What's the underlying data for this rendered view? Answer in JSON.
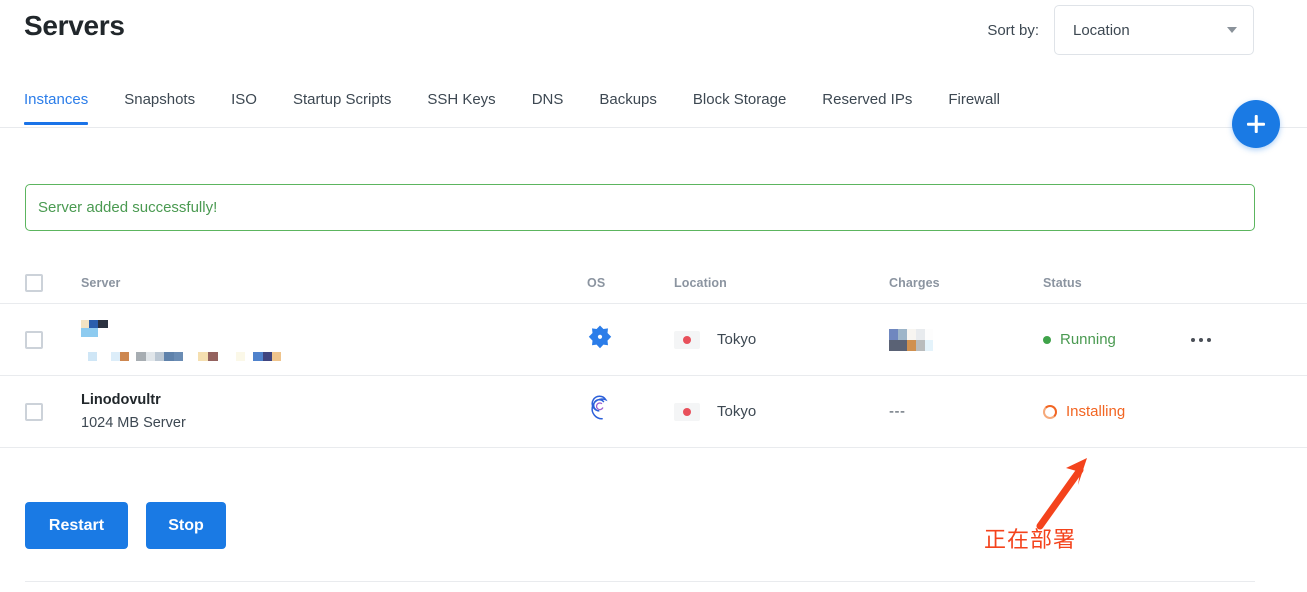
{
  "header": {
    "title": "Servers",
    "sort_label": "Sort by:",
    "sort_value": "Location",
    "sort_options": [
      "Location"
    ],
    "caret_icon": "chevron-down-icon"
  },
  "fab": {
    "icon": "plus-icon",
    "label": "+"
  },
  "tabs": [
    {
      "label": "Instances",
      "active": true
    },
    {
      "label": "Snapshots",
      "active": false
    },
    {
      "label": "ISO",
      "active": false
    },
    {
      "label": "Startup Scripts",
      "active": false
    },
    {
      "label": "SSH Keys",
      "active": false
    },
    {
      "label": "DNS",
      "active": false
    },
    {
      "label": "Backups",
      "active": false
    },
    {
      "label": "Block Storage",
      "active": false
    },
    {
      "label": "Reserved IPs",
      "active": false
    },
    {
      "label": "Firewall",
      "active": false
    }
  ],
  "alert": {
    "message": "Server added successfully!",
    "border_color": "#5cb55f",
    "text_color": "#4a9a51"
  },
  "table": {
    "columns": [
      "Server",
      "OS",
      "Location",
      "Charges",
      "Status"
    ],
    "rows": [
      {
        "server_name": "",
        "server_sub": "",
        "redacted": true,
        "os_icon": "vultr-starburst-icon",
        "location": "Tokyo",
        "flag_icon": "japan-flag-icon",
        "charges": "",
        "charges_redacted": true,
        "status": "Running",
        "status_icon": "green-dot-icon",
        "status_color": "#4a9a51",
        "menu_icon": "kebab-menu-icon"
      },
      {
        "server_name": "Linodovultr",
        "server_sub": "1024 MB Server",
        "redacted": false,
        "os_icon": "debian-swirl-icon",
        "location": "Tokyo",
        "flag_icon": "japan-flag-icon",
        "charges": "---",
        "charges_redacted": false,
        "status": "Installing",
        "status_icon": "spinner-icon",
        "status_color": "#f26522",
        "menu_icon": ""
      }
    ]
  },
  "actions": [
    {
      "label": "Restart",
      "name": "restart-button"
    },
    {
      "label": "Stop",
      "name": "stop-button"
    }
  ],
  "annotation": {
    "text": "正在部署",
    "color": "#f4431c",
    "arrow_icon": "arrow-up-right-icon"
  },
  "colors": {
    "accent_blue": "#1a7ae4",
    "tab_active": "#1a73e8",
    "success_green": "#4a9a51",
    "installing_orange": "#f26522",
    "flag_red": "#e8505b",
    "annotation_red": "#f4431c"
  }
}
